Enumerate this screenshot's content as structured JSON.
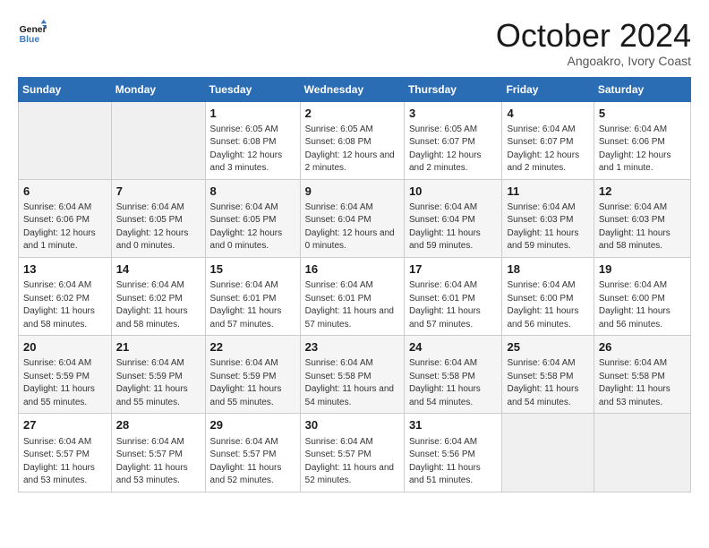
{
  "logo": {
    "text_general": "General",
    "text_blue": "Blue"
  },
  "header": {
    "month": "October 2024",
    "location": "Angoakro, Ivory Coast"
  },
  "weekdays": [
    "Sunday",
    "Monday",
    "Tuesday",
    "Wednesday",
    "Thursday",
    "Friday",
    "Saturday"
  ],
  "weeks": [
    [
      {
        "day": "",
        "info": ""
      },
      {
        "day": "",
        "info": ""
      },
      {
        "day": "1",
        "info": "Sunrise: 6:05 AM\nSunset: 6:08 PM\nDaylight: 12 hours and 3 minutes."
      },
      {
        "day": "2",
        "info": "Sunrise: 6:05 AM\nSunset: 6:08 PM\nDaylight: 12 hours and 2 minutes."
      },
      {
        "day": "3",
        "info": "Sunrise: 6:05 AM\nSunset: 6:07 PM\nDaylight: 12 hours and 2 minutes."
      },
      {
        "day": "4",
        "info": "Sunrise: 6:04 AM\nSunset: 6:07 PM\nDaylight: 12 hours and 2 minutes."
      },
      {
        "day": "5",
        "info": "Sunrise: 6:04 AM\nSunset: 6:06 PM\nDaylight: 12 hours and 1 minute."
      }
    ],
    [
      {
        "day": "6",
        "info": "Sunrise: 6:04 AM\nSunset: 6:06 PM\nDaylight: 12 hours and 1 minute."
      },
      {
        "day": "7",
        "info": "Sunrise: 6:04 AM\nSunset: 6:05 PM\nDaylight: 12 hours and 0 minutes."
      },
      {
        "day": "8",
        "info": "Sunrise: 6:04 AM\nSunset: 6:05 PM\nDaylight: 12 hours and 0 minutes."
      },
      {
        "day": "9",
        "info": "Sunrise: 6:04 AM\nSunset: 6:04 PM\nDaylight: 12 hours and 0 minutes."
      },
      {
        "day": "10",
        "info": "Sunrise: 6:04 AM\nSunset: 6:04 PM\nDaylight: 11 hours and 59 minutes."
      },
      {
        "day": "11",
        "info": "Sunrise: 6:04 AM\nSunset: 6:03 PM\nDaylight: 11 hours and 59 minutes."
      },
      {
        "day": "12",
        "info": "Sunrise: 6:04 AM\nSunset: 6:03 PM\nDaylight: 11 hours and 58 minutes."
      }
    ],
    [
      {
        "day": "13",
        "info": "Sunrise: 6:04 AM\nSunset: 6:02 PM\nDaylight: 11 hours and 58 minutes."
      },
      {
        "day": "14",
        "info": "Sunrise: 6:04 AM\nSunset: 6:02 PM\nDaylight: 11 hours and 58 minutes."
      },
      {
        "day": "15",
        "info": "Sunrise: 6:04 AM\nSunset: 6:01 PM\nDaylight: 11 hours and 57 minutes."
      },
      {
        "day": "16",
        "info": "Sunrise: 6:04 AM\nSunset: 6:01 PM\nDaylight: 11 hours and 57 minutes."
      },
      {
        "day": "17",
        "info": "Sunrise: 6:04 AM\nSunset: 6:01 PM\nDaylight: 11 hours and 57 minutes."
      },
      {
        "day": "18",
        "info": "Sunrise: 6:04 AM\nSunset: 6:00 PM\nDaylight: 11 hours and 56 minutes."
      },
      {
        "day": "19",
        "info": "Sunrise: 6:04 AM\nSunset: 6:00 PM\nDaylight: 11 hours and 56 minutes."
      }
    ],
    [
      {
        "day": "20",
        "info": "Sunrise: 6:04 AM\nSunset: 5:59 PM\nDaylight: 11 hours and 55 minutes."
      },
      {
        "day": "21",
        "info": "Sunrise: 6:04 AM\nSunset: 5:59 PM\nDaylight: 11 hours and 55 minutes."
      },
      {
        "day": "22",
        "info": "Sunrise: 6:04 AM\nSunset: 5:59 PM\nDaylight: 11 hours and 55 minutes."
      },
      {
        "day": "23",
        "info": "Sunrise: 6:04 AM\nSunset: 5:58 PM\nDaylight: 11 hours and 54 minutes."
      },
      {
        "day": "24",
        "info": "Sunrise: 6:04 AM\nSunset: 5:58 PM\nDaylight: 11 hours and 54 minutes."
      },
      {
        "day": "25",
        "info": "Sunrise: 6:04 AM\nSunset: 5:58 PM\nDaylight: 11 hours and 54 minutes."
      },
      {
        "day": "26",
        "info": "Sunrise: 6:04 AM\nSunset: 5:58 PM\nDaylight: 11 hours and 53 minutes."
      }
    ],
    [
      {
        "day": "27",
        "info": "Sunrise: 6:04 AM\nSunset: 5:57 PM\nDaylight: 11 hours and 53 minutes."
      },
      {
        "day": "28",
        "info": "Sunrise: 6:04 AM\nSunset: 5:57 PM\nDaylight: 11 hours and 53 minutes."
      },
      {
        "day": "29",
        "info": "Sunrise: 6:04 AM\nSunset: 5:57 PM\nDaylight: 11 hours and 52 minutes."
      },
      {
        "day": "30",
        "info": "Sunrise: 6:04 AM\nSunset: 5:57 PM\nDaylight: 11 hours and 52 minutes."
      },
      {
        "day": "31",
        "info": "Sunrise: 6:04 AM\nSunset: 5:56 PM\nDaylight: 11 hours and 51 minutes."
      },
      {
        "day": "",
        "info": ""
      },
      {
        "day": "",
        "info": ""
      }
    ]
  ]
}
